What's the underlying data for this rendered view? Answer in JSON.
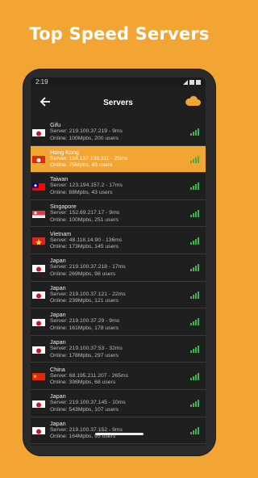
{
  "headline": "Top Speed Servers",
  "status": {
    "time": "2:19"
  },
  "appbar": {
    "title": "Servers",
    "back_icon": "arrow-left-icon",
    "cloud_icon": "cloud-icon",
    "accent": "#F2A533"
  },
  "servers": [
    {
      "country": "Gifu",
      "flag": "japan",
      "server": "Server: 219.100.37.219 - 9ms",
      "online": "Online: 100Mpbs, 200 users",
      "active": false
    },
    {
      "country": "Hong Kong",
      "flag": "hong-kong",
      "server": "Server: 118.137.133.111 - 25ms",
      "online": "Online: 75Mpbs, 43 users",
      "active": true
    },
    {
      "country": "Taiwan",
      "flag": "taiwan",
      "server": "Server: 123.194.157.2 - 17ms",
      "online": "Online: 88Mpbs, 43 users",
      "active": false
    },
    {
      "country": "Singapore",
      "flag": "singapore",
      "server": "Server: 152.69.217.17 - 9ms",
      "online": "Online: 100Mpbs, 251 users",
      "active": false
    },
    {
      "country": "Vietnam",
      "flag": "vietnam",
      "server": "Server: 48.118.14.90 - 136ms",
      "online": "Online: 173Mpbs, 145 users",
      "active": false
    },
    {
      "country": "Japan",
      "flag": "japan",
      "server": "Server: 219.100.37.218 - 17ms",
      "online": "Online: 269Mpbs, 98 users",
      "active": false
    },
    {
      "country": "Japan",
      "flag": "japan",
      "server": "Server: 219.100.37.121 - 22ms",
      "online": "Online: 239Mpbs, 121 users",
      "active": false
    },
    {
      "country": "Japan",
      "flag": "japan",
      "server": "Server: 219.100.37.29 - 9ms",
      "online": "Online: 161Mpbs, 178 users",
      "active": false
    },
    {
      "country": "Japan",
      "flag": "japan",
      "server": "Server: 219.100.37.53 - 32ms",
      "online": "Online: 178Mpbs, 297 users",
      "active": false
    },
    {
      "country": "China",
      "flag": "china",
      "server": "Server: 68.195.211.207 - 265ms",
      "online": "Online: 398Mpbs, 68 users",
      "active": false
    },
    {
      "country": "Japan",
      "flag": "japan",
      "server": "Server: 219.100.37.145 - 10ms",
      "online": "Online: 543Mpbs, 107 users",
      "active": false
    },
    {
      "country": "Japan",
      "flag": "japan",
      "server": "Server: 219.100.37.152 - 9ms",
      "online": "Online: 164Mpbs, 95 users",
      "active": false
    }
  ]
}
